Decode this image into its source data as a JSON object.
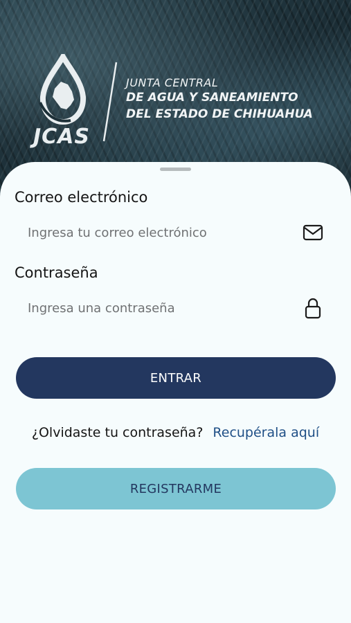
{
  "header": {
    "logo_text": "JCAS",
    "org_lines": [
      "JUNTA CENTRAL",
      "DE AGUA Y SANEAMIENTO",
      "DEL ESTADO DE CHIHUAHUA"
    ]
  },
  "form": {
    "email": {
      "label": "Correo electrónico",
      "placeholder": "Ingresa tu correo electrónico",
      "value": "",
      "icon": "mail-icon"
    },
    "password": {
      "label": "Contraseña",
      "placeholder": "Ingresa una contraseña",
      "value": "",
      "icon": "lock-icon"
    },
    "login_label": "ENTRAR",
    "forgot_text": "¿Olvidaste tu contraseña?",
    "recover_link": "Recupérala aquí",
    "register_label": "REGISTRARME"
  },
  "colors": {
    "primary": "#23375f",
    "secondary": "#7dc5d3",
    "link": "#1f4f86",
    "background": "#f6fcfd"
  }
}
